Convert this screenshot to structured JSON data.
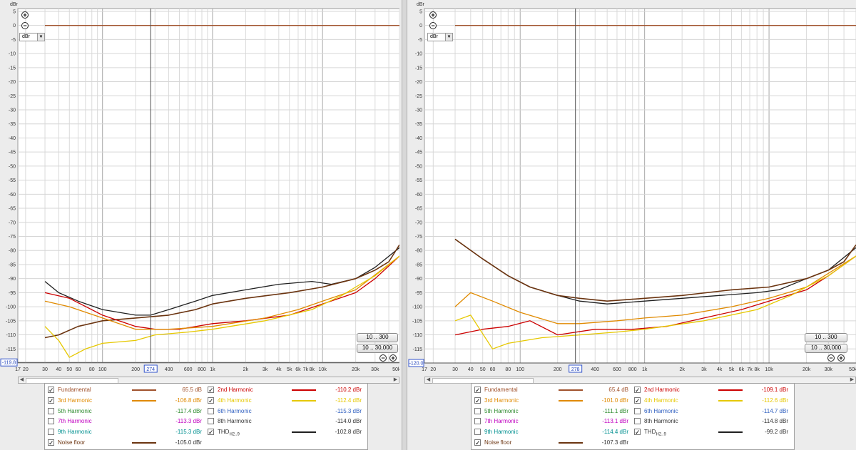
{
  "y_unit_label": "dBr",
  "y_ticks": [
    5,
    0,
    -5,
    -10,
    -15,
    -20,
    -25,
    -30,
    -35,
    -40,
    -45,
    -50,
    -55,
    -60,
    -65,
    -70,
    -75,
    -80,
    -85,
    -90,
    -95,
    -100,
    -105,
    -110,
    -115
  ],
  "x_ticks": [
    {
      "value": 17,
      "label": "17"
    },
    {
      "value": 20,
      "label": "20"
    },
    {
      "value": 30,
      "label": "30"
    },
    {
      "value": 40,
      "label": "40"
    },
    {
      "value": 50,
      "label": "50"
    },
    {
      "value": 60,
      "label": "60"
    },
    {
      "value": 80,
      "label": "80"
    },
    {
      "value": 100,
      "label": "100"
    },
    {
      "value": 200,
      "label": "200"
    },
    {
      "value": 400,
      "label": "400"
    },
    {
      "value": 600,
      "label": "600"
    },
    {
      "value": 800,
      "label": "800"
    },
    {
      "value": 1000,
      "label": "1k"
    },
    {
      "value": 2000,
      "label": "2k"
    },
    {
      "value": 3000,
      "label": "3k"
    },
    {
      "value": 4000,
      "label": "4k"
    },
    {
      "value": 5000,
      "label": "5k"
    },
    {
      "value": 6000,
      "label": "6k"
    },
    {
      "value": 7000,
      "label": "7k"
    },
    {
      "value": 8000,
      "label": "8k"
    },
    {
      "value": 10000,
      "label": "10k"
    },
    {
      "value": 20000,
      "label": "20k"
    },
    {
      "value": 30000,
      "label": "30k"
    },
    {
      "value": 50000,
      "label": "50kHz"
    }
  ],
  "buttons": {
    "range_short": "10 .. 300",
    "range_full": "10 .. 30,000"
  },
  "icons": {
    "zoom_in": "zoom-in-icon",
    "zoom_out": "zoom-out-icon",
    "dropdown": "chevron-down-icon",
    "scroll_left": "arrow-left-icon",
    "scroll_right": "arrow-right-icon"
  },
  "series_colors": {
    "fundamental": "#a0522d",
    "h2": "#cc0000",
    "h3": "#e08a00",
    "h4": "#e6c800",
    "h5": "#2e8b2e",
    "h6": "#3060c0",
    "h7": "#c000c0",
    "h8": "#606060",
    "h9": "#009090",
    "thd": "#202020",
    "noise": "#6b3410"
  },
  "panels": [
    {
      "cursor_freq_label": "274",
      "cursor_level_label": "-119.8",
      "legend": [
        {
          "key": "fundamental",
          "label": "Fundamental",
          "value": "65.5 dB",
          "checked": true
        },
        {
          "key": "h2",
          "label": "2nd Harmonic",
          "value": "-110.2 dBr",
          "checked": true
        },
        {
          "key": "h3",
          "label": "3rd Harmonic",
          "value": "-106.8 dBr",
          "checked": true
        },
        {
          "key": "h4",
          "label": "4th Harmonic",
          "value": "-112.4 dBr",
          "checked": true
        },
        {
          "key": "h5",
          "label": "5th Harmonic",
          "value": "-117.4 dBr",
          "checked": false
        },
        {
          "key": "h6",
          "label": "6th Harmonic",
          "value": "-115.3 dBr",
          "checked": false
        },
        {
          "key": "h7",
          "label": "7th Harmonic",
          "value": "-113.3 dBr",
          "checked": false
        },
        {
          "key": "h8",
          "label": "8th Harmonic",
          "value": "-114.0 dBr",
          "checked": false
        },
        {
          "key": "h9",
          "label": "9th Harmonic",
          "value": "-115.3 dBr",
          "checked": false
        },
        {
          "key": "thd",
          "label": "THD",
          "label_sub": "H2..9",
          "value": "-102.8 dBr",
          "checked": true
        },
        {
          "key": "noise",
          "label": "Noise floor",
          "value": "-105.0 dBr",
          "checked": true
        }
      ]
    },
    {
      "cursor_freq_label": "278",
      "cursor_level_label": "-120.0",
      "legend": [
        {
          "key": "fundamental",
          "label": "Fundamental",
          "value": "65.4 dB",
          "checked": true
        },
        {
          "key": "h2",
          "label": "2nd Harmonic",
          "value": "-109.1 dBr",
          "checked": true
        },
        {
          "key": "h3",
          "label": "3rd Harmonic",
          "value": "-101.0 dBr",
          "checked": true
        },
        {
          "key": "h4",
          "label": "4th Harmonic",
          "value": "-112.6 dBr",
          "checked": true
        },
        {
          "key": "h5",
          "label": "5th Harmonic",
          "value": "-111.1 dBr",
          "checked": false
        },
        {
          "key": "h6",
          "label": "6th Harmonic",
          "value": "-114.7 dBr",
          "checked": false
        },
        {
          "key": "h7",
          "label": "7th Harmonic",
          "value": "-113.1 dBr",
          "checked": false
        },
        {
          "key": "h8",
          "label": "8th Harmonic",
          "value": "-114.8 dBr",
          "checked": false
        },
        {
          "key": "h9",
          "label": "9th Harmonic",
          "value": "-114.4 dBr",
          "checked": false
        },
        {
          "key": "thd",
          "label": "THD",
          "label_sub": "H2..9",
          "value": "-99.2 dBr",
          "checked": true
        },
        {
          "key": "noise",
          "label": "Noise floor",
          "value": "-107.3 dBr",
          "checked": true
        }
      ]
    }
  ],
  "chart_data": [
    {
      "type": "line",
      "x_scale": "log",
      "xlim": [
        17,
        50000
      ],
      "ylim": [
        -120,
        6
      ],
      "grid": true,
      "ylabel": "dBr",
      "series": [
        {
          "key": "fundamental",
          "points": [
            [
              30,
              0
            ],
            [
              50000,
              0
            ]
          ]
        },
        {
          "key": "thd",
          "points": [
            [
              30,
              -91
            ],
            [
              40,
              -95
            ],
            [
              60,
              -98
            ],
            [
              100,
              -101
            ],
            [
              200,
              -103
            ],
            [
              274,
              -103
            ],
            [
              400,
              -101
            ],
            [
              700,
              -98
            ],
            [
              1000,
              -96
            ],
            [
              2000,
              -94
            ],
            [
              4000,
              -92
            ],
            [
              8000,
              -91
            ],
            [
              12000,
              -92
            ],
            [
              20000,
              -90
            ],
            [
              30000,
              -86
            ],
            [
              50000,
              -79
            ]
          ]
        },
        {
          "key": "noise",
          "points": [
            [
              30,
              -111
            ],
            [
              40,
              -110
            ],
            [
              60,
              -107
            ],
            [
              100,
              -105
            ],
            [
              200,
              -104
            ],
            [
              400,
              -103
            ],
            [
              700,
              -101
            ],
            [
              1000,
              -99
            ],
            [
              2000,
              -97
            ],
            [
              5000,
              -95
            ],
            [
              10000,
              -93
            ],
            [
              20000,
              -90
            ],
            [
              30000,
              -87
            ],
            [
              40000,
              -84
            ],
            [
              50000,
              -78
            ]
          ]
        },
        {
          "key": "h2",
          "points": [
            [
              30,
              -95
            ],
            [
              50,
              -97
            ],
            [
              100,
              -103
            ],
            [
              200,
              -107
            ],
            [
              300,
              -108
            ],
            [
              500,
              -108
            ],
            [
              1000,
              -106
            ],
            [
              2000,
              -105
            ],
            [
              5000,
              -103
            ],
            [
              10000,
              -99
            ],
            [
              20000,
              -95
            ],
            [
              30000,
              -90
            ],
            [
              50000,
              -82
            ]
          ]
        },
        {
          "key": "h3",
          "points": [
            [
              30,
              -98
            ],
            [
              50,
              -100
            ],
            [
              100,
              -104
            ],
            [
              200,
              -108
            ],
            [
              400,
              -108
            ],
            [
              1000,
              -107
            ],
            [
              3000,
              -104
            ],
            [
              6000,
              -101
            ],
            [
              10000,
              -98
            ],
            [
              20000,
              -94
            ],
            [
              50000,
              -82
            ]
          ]
        },
        {
          "key": "h4",
          "points": [
            [
              30,
              -107
            ],
            [
              40,
              -112
            ],
            [
              50,
              -118
            ],
            [
              70,
              -115
            ],
            [
              100,
              -113
            ],
            [
              200,
              -112
            ],
            [
              300,
              -110
            ],
            [
              600,
              -109
            ],
            [
              1000,
              -108
            ],
            [
              3000,
              -105
            ],
            [
              8000,
              -101
            ],
            [
              15000,
              -96
            ],
            [
              20000,
              -93
            ],
            [
              30000,
              -89
            ],
            [
              50000,
              -82
            ]
          ]
        }
      ]
    },
    {
      "type": "line",
      "x_scale": "log",
      "xlim": [
        17,
        50000
      ],
      "ylim": [
        -120,
        6
      ],
      "grid": true,
      "ylabel": "dBr",
      "series": [
        {
          "key": "fundamental",
          "points": [
            [
              30,
              0
            ],
            [
              50000,
              0
            ]
          ]
        },
        {
          "key": "thd",
          "points": [
            [
              30,
              -76
            ],
            [
              50,
              -83
            ],
            [
              80,
              -89
            ],
            [
              120,
              -93
            ],
            [
              200,
              -96
            ],
            [
              300,
              -98
            ],
            [
              500,
              -99
            ],
            [
              1000,
              -98
            ],
            [
              2000,
              -97
            ],
            [
              4000,
              -96
            ],
            [
              8000,
              -95
            ],
            [
              12000,
              -94
            ],
            [
              20000,
              -90
            ],
            [
              30000,
              -87
            ],
            [
              50000,
              -79
            ]
          ]
        },
        {
          "key": "noise",
          "points": [
            [
              30,
              -76
            ],
            [
              50,
              -83
            ],
            [
              80,
              -89
            ],
            [
              120,
              -93
            ],
            [
              200,
              -96
            ],
            [
              300,
              -97
            ],
            [
              500,
              -98
            ],
            [
              1000,
              -97
            ],
            [
              2000,
              -96
            ],
            [
              5000,
              -94
            ],
            [
              10000,
              -93
            ],
            [
              20000,
              -90
            ],
            [
              30000,
              -87
            ],
            [
              40000,
              -84
            ],
            [
              50000,
              -78
            ]
          ]
        },
        {
          "key": "h2",
          "points": [
            [
              30,
              -110
            ],
            [
              50,
              -108
            ],
            [
              80,
              -107
            ],
            [
              120,
              -105
            ],
            [
              200,
              -110
            ],
            [
              400,
              -108
            ],
            [
              800,
              -108
            ],
            [
              1500,
              -107
            ],
            [
              3000,
              -104
            ],
            [
              6000,
              -101
            ],
            [
              10000,
              -98
            ],
            [
              20000,
              -94
            ],
            [
              30000,
              -89
            ],
            [
              50000,
              -82
            ]
          ]
        },
        {
          "key": "h3",
          "points": [
            [
              30,
              -100
            ],
            [
              40,
              -95
            ],
            [
              60,
              -98
            ],
            [
              100,
              -102
            ],
            [
              200,
              -106
            ],
            [
              300,
              -106
            ],
            [
              600,
              -105
            ],
            [
              1000,
              -104
            ],
            [
              2000,
              -103
            ],
            [
              5000,
              -100
            ],
            [
              10000,
              -97
            ],
            [
              20000,
              -93
            ],
            [
              50000,
              -82
            ]
          ]
        },
        {
          "key": "h4",
          "points": [
            [
              30,
              -105
            ],
            [
              40,
              -103
            ],
            [
              60,
              -115
            ],
            [
              80,
              -113
            ],
            [
              150,
              -111
            ],
            [
              300,
              -110
            ],
            [
              600,
              -109
            ],
            [
              1000,
              -108
            ],
            [
              3000,
              -105
            ],
            [
              8000,
              -101
            ],
            [
              15000,
              -96
            ],
            [
              20000,
              -93
            ],
            [
              30000,
              -89
            ],
            [
              50000,
              -82
            ]
          ]
        }
      ]
    }
  ]
}
